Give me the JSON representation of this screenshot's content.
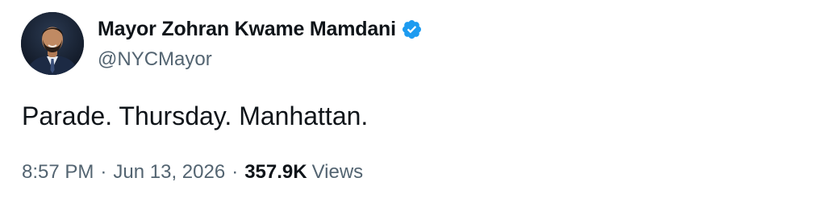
{
  "author": {
    "display_name": "Mayor Zohran Kwame Mamdani",
    "handle": "@NYCMayor",
    "verified": true,
    "avatar_icon": "profile-photo",
    "verified_icon": "verified-badge-icon",
    "verified_color": "#1d9bf0"
  },
  "tweet": {
    "text": "Parade. Thursday. Manhattan.",
    "time": "8:57 PM",
    "date": "Jun 13, 2026",
    "separator": "·",
    "views_count": "357.9K",
    "views_label": "Views"
  }
}
